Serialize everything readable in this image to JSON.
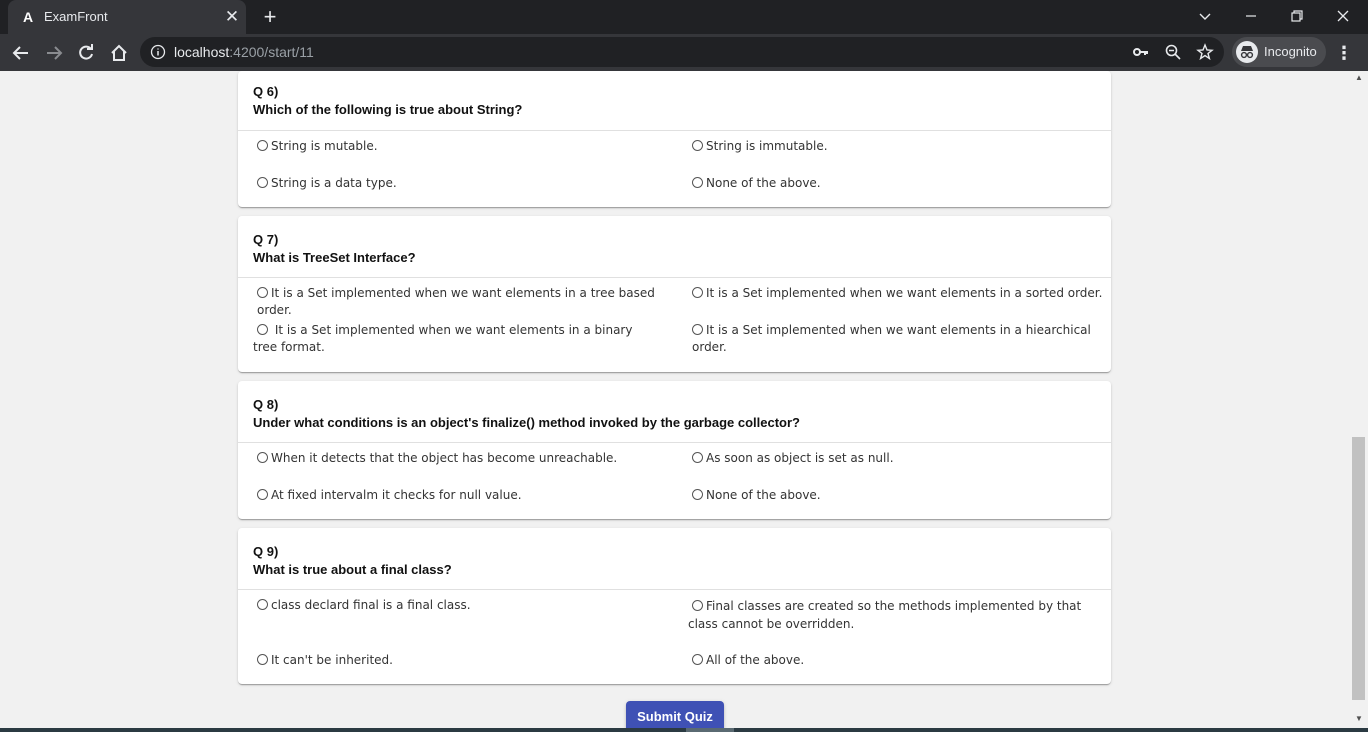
{
  "browser": {
    "tab_title": "ExamFront",
    "favicon": "A",
    "url_host": "localhost",
    "url_path": ":4200/start/11",
    "profile_label": "Incognito"
  },
  "questions": [
    {
      "number": "Q 6)",
      "text": "Which of the following is true about String?",
      "options": [
        "String is mutable.",
        "String is immutable.",
        "String is a data type.",
        "None of the above."
      ]
    },
    {
      "number": "Q 7)",
      "text": "What is TreeSet Interface?",
      "options": [
        "It is a Set implemented when we want elements in a tree based order.",
        "It is a Set implemented when we want elements in a sorted order.",
        " It is a Set implemented when we want elements in a binary tree format.",
        "It is a Set implemented when we want elements in a hiearchical order."
      ]
    },
    {
      "number": "Q 8)",
      "text": "Under what conditions is an object's finalize() method invoked by the garbage collector?",
      "options": [
        "When it detects that the object has become unreachable.",
        "As soon as object is set as null.",
        "At fixed intervalm it checks for null value.",
        "None of the above."
      ]
    },
    {
      "number": "Q 9)",
      "text": "What is true about a final class?",
      "options": [
        "class declard final is a final class.",
        "Final classes are created so the methods implemented by that class cannot be overridden.",
        "It can't be inherited.",
        "All of the above."
      ]
    }
  ],
  "submit_label": "Submit Quiz",
  "colors": {
    "accent": "#3f51b5",
    "chrome_dark": "#202124",
    "chrome_toolbar": "#35363a"
  }
}
